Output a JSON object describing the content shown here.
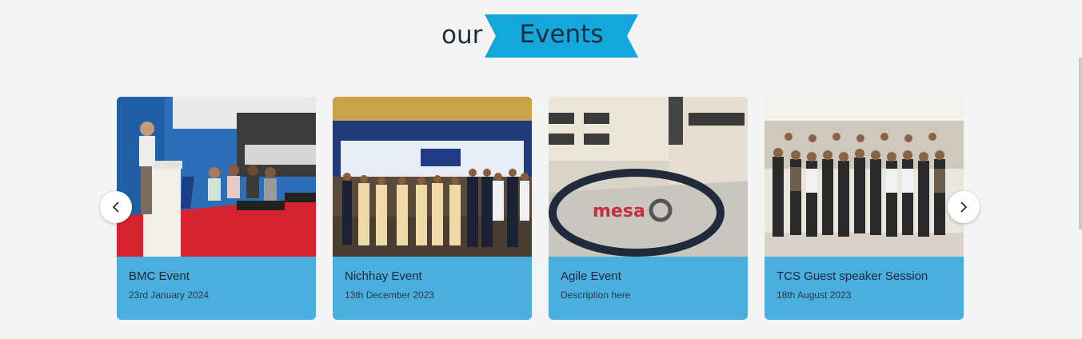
{
  "section_heading": {
    "prefix": "our",
    "ribbon_text": "Events",
    "ribbon_color": "#14a7dc"
  },
  "carousel": {
    "prev_icon": "chevron-left-icon",
    "next_icon": "chevron-right-icon",
    "cards": [
      {
        "title": "BMC Event",
        "subtitle": "23rd January 2024"
      },
      {
        "title": "Nichhay Event",
        "subtitle": "13th December 2023"
      },
      {
        "title": "Agile Event",
        "subtitle": "Description here"
      },
      {
        "title": "TCS Guest speaker Session",
        "subtitle": "18th August 2023"
      }
    ]
  },
  "colors": {
    "card_caption_bg": "#4aaedf",
    "page_bg": "#f4f4f4",
    "text_dark": "#1c2733"
  }
}
